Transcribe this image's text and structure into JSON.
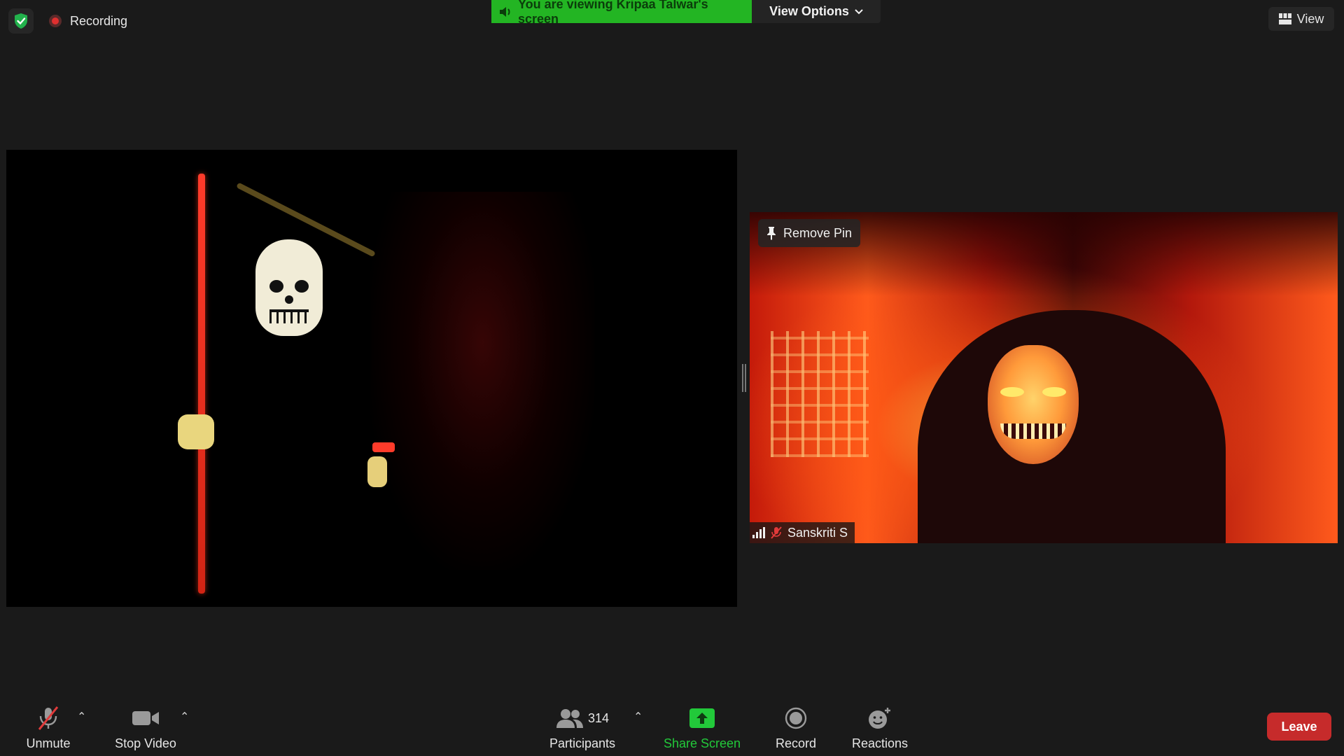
{
  "top": {
    "recording_label": "Recording",
    "viewing_banner": "You are viewing Kripaa Talwar's screen",
    "view_options_label": "View Options",
    "view_label": "View"
  },
  "pinned": {
    "remove_pin_label": "Remove Pin",
    "participant_name": "Sanskriti S"
  },
  "toolbar": {
    "unmute_label": "Unmute",
    "stop_video_label": "Stop Video",
    "participants_label": "Participants",
    "participants_count": "314",
    "share_screen_label": "Share Screen",
    "record_label": "Record",
    "reactions_label": "Reactions",
    "leave_label": "Leave"
  },
  "colors": {
    "banner_green": "#23b523",
    "share_green": "#22c93a",
    "leave_red": "#c62b2b",
    "recording_red": "#e02f2f",
    "background": "#1a1a1a"
  },
  "icons": [
    "shield-check-icon",
    "recording-dot-icon",
    "speaker-icon",
    "chevron-down-icon",
    "grid-view-icon",
    "pin-icon",
    "signal-bars-icon",
    "mic-muted-icon",
    "video-camera-icon",
    "participants-icon",
    "share-screen-arrow-icon",
    "record-icon",
    "reactions-icon"
  ]
}
